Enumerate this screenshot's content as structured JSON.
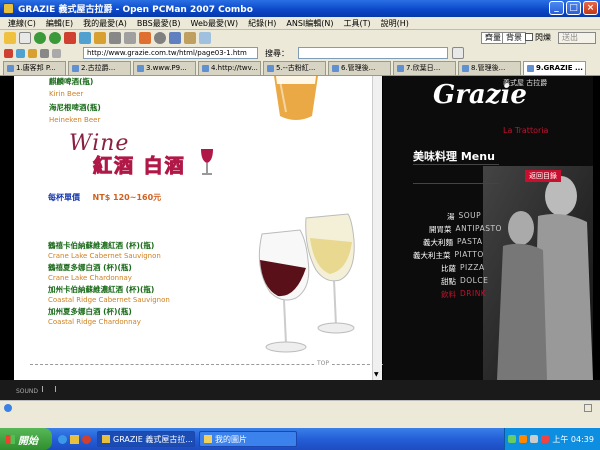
{
  "window": {
    "title": "GRAZIE 義式屋古拉爵 - Open PCMan 2007 Combo"
  },
  "menu": [
    "連線(C)",
    "編輯(E)",
    "我的最愛(A)",
    "BBS最愛(B)",
    "Web最愛(W)",
    "紀錄(H)",
    "ANSI編輯(N)",
    "工具(T)",
    "說明(H)"
  ],
  "toolbar": {
    "right_buttons": [
      "齊量",
      "背景"
    ],
    "checkbox_label": "閃爍",
    "dropdown": "送出"
  },
  "address": {
    "value": "http://www.grazie.com.tw/html/page03-1.htm",
    "search_label": "搜尋："
  },
  "tabs": [
    "1.唐客邦 P...",
    "2.古拉爵...",
    "3.www.P9...",
    "4.http://twv...",
    "5.--古粉紅...",
    "6.管理後...",
    "7.欣葉日...",
    "8.管理後...",
    "9.GRAZIE ..."
  ],
  "page": {
    "beer1_zh": "麒麟啤酒(瓶)",
    "beer1_en": "Kirin Beer",
    "beer2_zh": "海尼根啤酒(瓶)",
    "beer2_en": "Heineken Beer",
    "wine_script": "Wine",
    "wine_zh": "紅酒 白酒",
    "price_label": "每杯單價",
    "price_value": "NT$ 120~160元",
    "wines": [
      {
        "zh": "鶴禧卡伯納蘇維濃紅酒 (杯)(瓶)",
        "en": "Crane Lake Cabernet Sauvignon"
      },
      {
        "zh": "鶴禧夏多娜白酒 (杯)(瓶)",
        "en": "Crane Lake Chardonnay"
      },
      {
        "zh": "加州卡伯納蘇維濃紅酒 (杯)(瓶)",
        "en": "Coastal Ridge Cabernet Sauvignon"
      },
      {
        "zh": "加州夏多娜白酒 (杯)(瓶)",
        "en": "Coastal Ridge Chardonnay"
      }
    ],
    "top_link": "TOP",
    "sound_label": "SOUND"
  },
  "sidebar": {
    "logo_script": "Grazie",
    "logo_zh": "義式屋 古拉爵",
    "subtitle": "La Trattoria",
    "menu_title": "美味料理 Menu",
    "back_button": "返回目錄",
    "items": [
      {
        "zh": "湯",
        "en": "SOUP"
      },
      {
        "zh": "開胃菜",
        "en": "ANTIPASTO"
      },
      {
        "zh": "義大利麵",
        "en": "PASTA"
      },
      {
        "zh": "義大利主菜",
        "en": "PIATTO"
      },
      {
        "zh": "比薩",
        "en": "PIZZA"
      },
      {
        "zh": "甜點",
        "en": "DOLCE"
      },
      {
        "zh": "飲料",
        "en": "DRINK"
      }
    ]
  },
  "taskbar": {
    "start": "開始",
    "items": [
      "GRAZIE 義式屋古拉...",
      "我的圖片"
    ],
    "clock": "上午 04:39"
  },
  "colors": {
    "accent": "#c8102e",
    "green": "#1a6a1a",
    "orange": "#d08020",
    "titlebar": "#0a46c8"
  }
}
